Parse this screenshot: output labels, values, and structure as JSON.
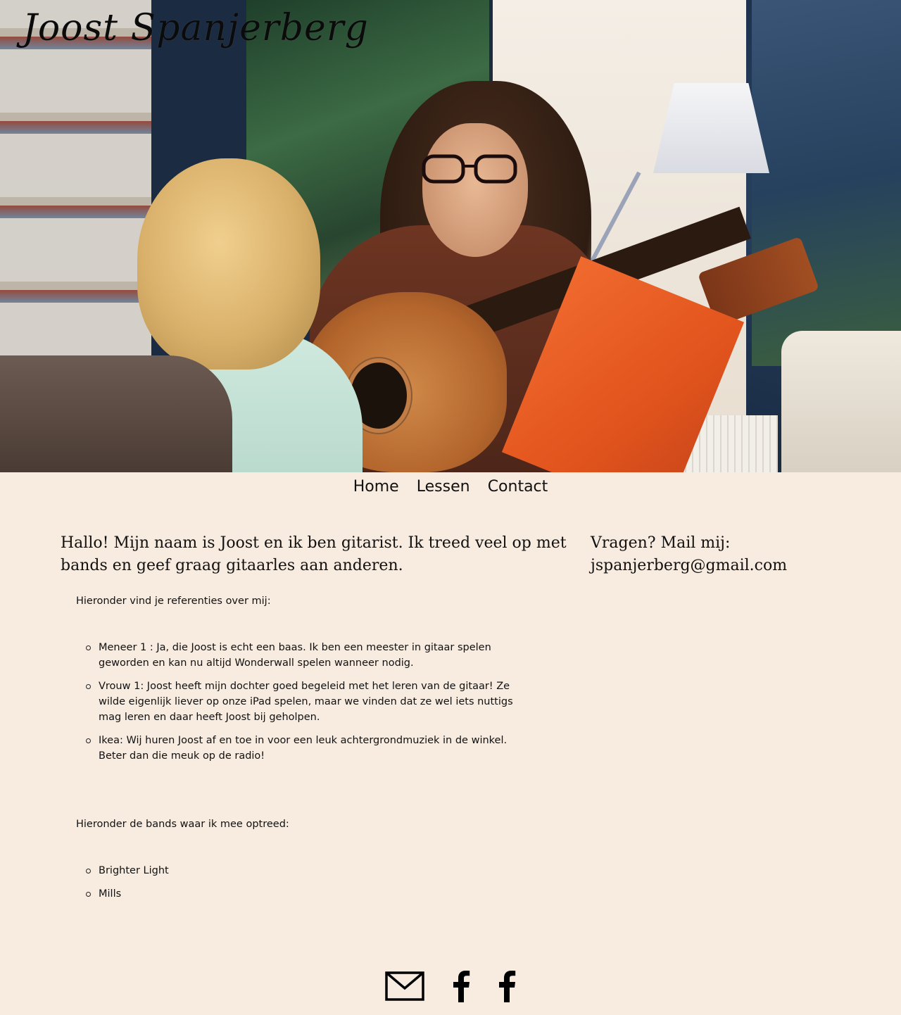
{
  "site": {
    "title": "Joost Spanjerberg"
  },
  "hero": {
    "image_icon": "hero-photo"
  },
  "nav": {
    "items": [
      "Home",
      "Lessen",
      "Contact"
    ]
  },
  "intro": "Hallo! Mijn naam is Joost en ik ben gitarist. Ik treed veel op met bands en geef graag gitaarles aan anderen.",
  "contact": {
    "line1": "Vragen? Mail mij:",
    "email": "jspanjerberg@gmail.com"
  },
  "references": {
    "intro": "Hieronder vind je referenties over mij:",
    "items": [
      "Meneer 1 : Ja, die Joost is echt een baas. Ik ben een meester in gitaar spelen geworden en kan nu altijd Wonderwall spelen wanneer nodig.",
      "Vrouw 1: Joost heeft mijn dochter goed begeleid met het leren van de gitaar! Ze wilde eigenlijk liever op onze iPad spelen, maar we vinden dat ze wel iets nuttigs mag leren en daar heeft Joost bij geholpen.",
      "Ikea: Wij huren Joost af en toe in voor een leuk achtergrondmuziek in de winkel. Beter dan die meuk op de radio!"
    ]
  },
  "bands": {
    "intro": "Hieronder de bands waar ik mee optreed:",
    "items": [
      "Brighter Light",
      "Mills"
    ]
  },
  "footer": {
    "icons": [
      "mail-icon",
      "facebook-icon",
      "facebook-icon"
    ]
  },
  "colors": {
    "background": "#f8ece1",
    "text": "#111111"
  }
}
